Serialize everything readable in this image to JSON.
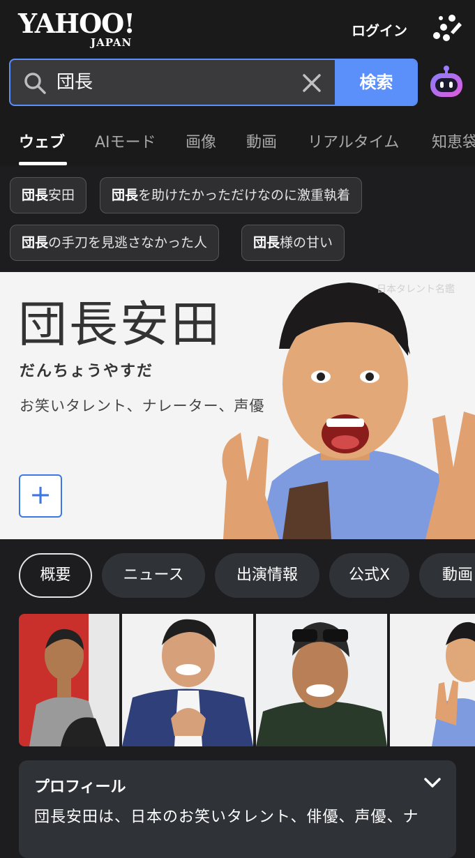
{
  "header": {
    "logo_main": "YAHOO!",
    "logo_sub": "JAPAN",
    "login_label": "ログイン"
  },
  "search": {
    "value": "団長",
    "button_label": "検索"
  },
  "tabs": [
    {
      "label": "ウェブ",
      "active": true
    },
    {
      "label": "AIモード",
      "active": false
    },
    {
      "label": "画像",
      "active": false
    },
    {
      "label": "動画",
      "active": false
    },
    {
      "label": "リアルタイム",
      "active": false
    },
    {
      "label": "知恵袋",
      "active": false
    }
  ],
  "suggestions": [
    {
      "bold": "団長",
      "rest": "安田"
    },
    {
      "bold": "団長",
      "rest": "を助けたかっただけなのに激重執着"
    },
    {
      "bold": "団長",
      "rest": "の手刀を見逃さなかった人"
    },
    {
      "bold": "団長",
      "rest": "様の甘い"
    }
  ],
  "hero": {
    "name": "団長安田",
    "reading": "だんちょうやすだ",
    "description": "お笑いタレント、ナレーター、声優",
    "credit": "日本タレント名鑑",
    "plus_label": "+"
  },
  "nav_pills": [
    {
      "label": "概要",
      "active": true
    },
    {
      "label": "ニュース",
      "active": false
    },
    {
      "label": "出演情報",
      "active": false
    },
    {
      "label": "公式X",
      "active": false
    },
    {
      "label": "動画",
      "active": false
    }
  ],
  "profile": {
    "title": "プロフィール",
    "text": "団長安田は、日本のお笑いタレント、俳優、声優、ナ"
  },
  "colors": {
    "accent": "#5b8ff9",
    "background": "#1d1d1f",
    "chip_bg": "#2f2f31",
    "pill_bg": "#2f3237"
  }
}
